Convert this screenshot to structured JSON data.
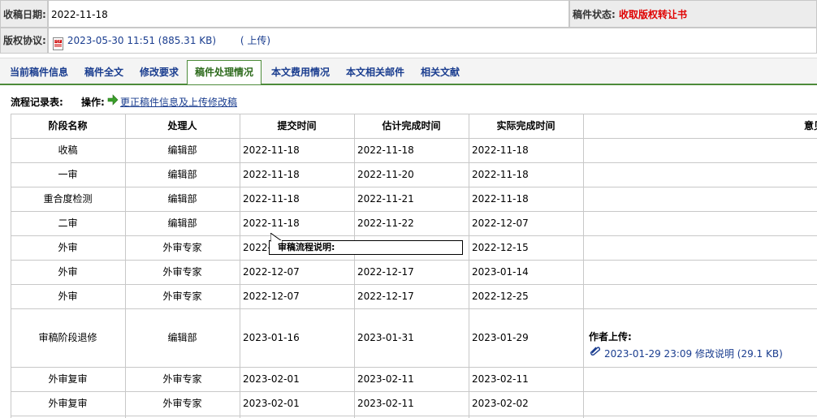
{
  "info": {
    "receive_date_label": "收稿日期:",
    "receive_date": "2022-11-18",
    "status_label": "稿件状态:",
    "status_value": "收取版权转让书",
    "status_color": "#e00000",
    "copyright_label": "版权协议:",
    "copyright_file": "2023-05-30 11:51 (885.31 KB)",
    "upload_link": "( 上传)"
  },
  "tabs": [
    "当前稿件信息",
    "稿件全文",
    "修改要求",
    "稿件处理情况",
    "本文费用情况",
    "本文相关邮件",
    "相关文献"
  ],
  "active_tab": "稿件处理情况",
  "flow": {
    "label": "流程记录表:",
    "op_label": "操作:",
    "op_link": "更正稿件信息及上传修改稿"
  },
  "table": {
    "headers": [
      "阶段名称",
      "处理人",
      "提交时间",
      "估计完成时间",
      "实际完成时间",
      "意见"
    ],
    "rows": [
      [
        "收稿",
        "编辑部",
        "2022-11-18",
        "2022-11-18",
        "2022-11-18"
      ],
      [
        "一审",
        "编辑部",
        "2022-11-18",
        "2022-11-20",
        "2022-11-18"
      ],
      [
        "重合度检测",
        "编辑部",
        "2022-11-18",
        "2022-11-21",
        "2022-11-18"
      ],
      [
        "二审",
        "编辑部",
        "2022-11-18",
        "2022-11-22",
        "2022-12-07"
      ],
      [
        "外审",
        "外审专家",
        "2022-",
        "",
        "2022-12-15"
      ],
      [
        "外审",
        "外审专家",
        "2022-12-07",
        "2022-12-17",
        "2023-01-14"
      ],
      [
        "外审",
        "外审专家",
        "2022-12-07",
        "2022-12-17",
        "2022-12-25"
      ],
      [
        "审稿阶段退修",
        "编辑部",
        "2023-01-16",
        "2023-01-31",
        "2023-01-29"
      ],
      [
        "外审复审",
        "外审专家",
        "2023-02-01",
        "2023-02-11",
        "2023-02-11"
      ],
      [
        "外审复审",
        "外审专家",
        "2023-02-01",
        "2023-02-11",
        "2023-02-02"
      ]
    ],
    "author_upload_label": "作者上传:",
    "author_upload_file": "2023-01-29 23:09 修改说明 (29.1 KB)"
  },
  "tooltip": "审稿流程说明:"
}
